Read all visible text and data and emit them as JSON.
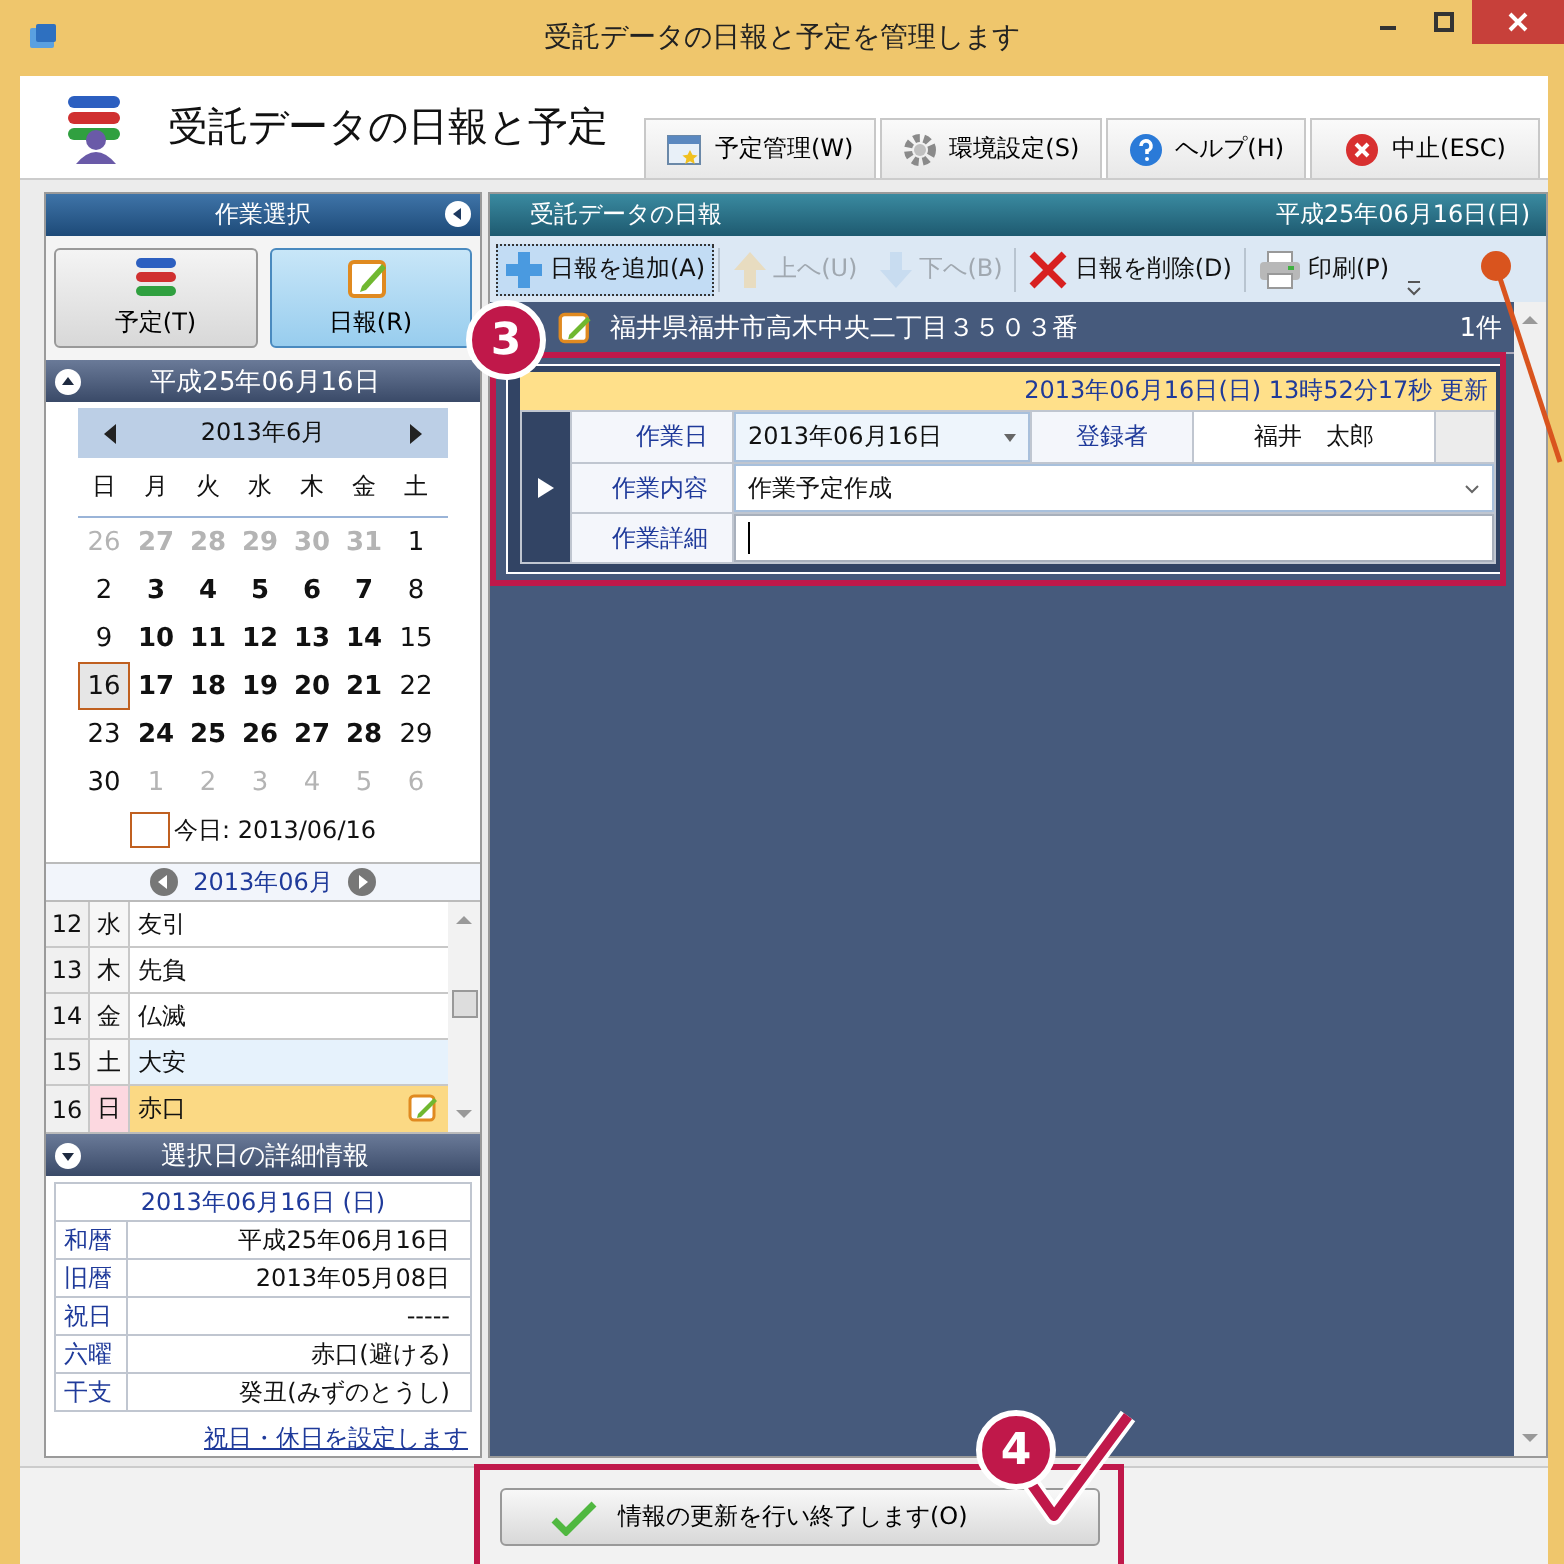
{
  "window": {
    "title": "受託データの日報と予定を管理します"
  },
  "header": {
    "title": "受託データの日報と予定",
    "buttons": [
      {
        "label": "予定管理(W)",
        "kind": "calendar"
      },
      {
        "label": "環境設定(S)",
        "kind": "gear"
      },
      {
        "label": "ヘルプ(H)",
        "kind": "help"
      },
      {
        "label": "中止(ESC)",
        "kind": "cancel"
      }
    ]
  },
  "left_panel": {
    "title": "作業選択",
    "modes": [
      {
        "label": "予定(T)",
        "kind": "schedule",
        "selected": false
      },
      {
        "label": "日報(R)",
        "kind": "report",
        "selected": true
      }
    ],
    "calendar": {
      "title": "平成25年06月16日",
      "month": "2013年6月",
      "weekdays": [
        "日",
        "月",
        "火",
        "水",
        "木",
        "金",
        "土"
      ],
      "weeks": [
        [
          {
            "day": "26",
            "outside": true,
            "bold": false,
            "selected": false
          },
          {
            "day": "27",
            "outside": true,
            "bold": true,
            "selected": false
          },
          {
            "day": "28",
            "outside": true,
            "bold": true,
            "selected": false
          },
          {
            "day": "29",
            "outside": true,
            "bold": true,
            "selected": false
          },
          {
            "day": "30",
            "outside": true,
            "bold": true,
            "selected": false
          },
          {
            "day": "31",
            "outside": true,
            "bold": true,
            "selected": false
          },
          {
            "day": "1",
            "outside": false,
            "bold": false,
            "selected": false
          }
        ],
        [
          {
            "day": "2",
            "outside": false,
            "bold": false,
            "selected": false
          },
          {
            "day": "3",
            "outside": false,
            "bold": true,
            "selected": false
          },
          {
            "day": "4",
            "outside": false,
            "bold": true,
            "selected": false
          },
          {
            "day": "5",
            "outside": false,
            "bold": true,
            "selected": false
          },
          {
            "day": "6",
            "outside": false,
            "bold": true,
            "selected": false
          },
          {
            "day": "7",
            "outside": false,
            "bold": true,
            "selected": false
          },
          {
            "day": "8",
            "outside": false,
            "bold": false,
            "selected": false
          }
        ],
        [
          {
            "day": "9",
            "outside": false,
            "bold": false,
            "selected": false
          },
          {
            "day": "10",
            "outside": false,
            "bold": true,
            "selected": false
          },
          {
            "day": "11",
            "outside": false,
            "bold": true,
            "selected": false
          },
          {
            "day": "12",
            "outside": false,
            "bold": true,
            "selected": false
          },
          {
            "day": "13",
            "outside": false,
            "bold": true,
            "selected": false
          },
          {
            "day": "14",
            "outside": false,
            "bold": true,
            "selected": false
          },
          {
            "day": "15",
            "outside": false,
            "bold": false,
            "selected": false
          }
        ],
        [
          {
            "day": "16",
            "outside": false,
            "bold": false,
            "selected": true
          },
          {
            "day": "17",
            "outside": false,
            "bold": true,
            "selected": false
          },
          {
            "day": "18",
            "outside": false,
            "bold": true,
            "selected": false
          },
          {
            "day": "19",
            "outside": false,
            "bold": true,
            "selected": false
          },
          {
            "day": "20",
            "outside": false,
            "bold": true,
            "selected": false
          },
          {
            "day": "21",
            "outside": false,
            "bold": true,
            "selected": false
          },
          {
            "day": "22",
            "outside": false,
            "bold": false,
            "selected": false
          }
        ],
        [
          {
            "day": "23",
            "outside": false,
            "bold": false,
            "selected": false
          },
          {
            "day": "24",
            "outside": false,
            "bold": true,
            "selected": false
          },
          {
            "day": "25",
            "outside": false,
            "bold": true,
            "selected": false
          },
          {
            "day": "26",
            "outside": false,
            "bold": true,
            "selected": false
          },
          {
            "day": "27",
            "outside": false,
            "bold": true,
            "selected": false
          },
          {
            "day": "28",
            "outside": false,
            "bold": true,
            "selected": false
          },
          {
            "day": "29",
            "outside": false,
            "bold": false,
            "selected": false
          }
        ],
        [
          {
            "day": "30",
            "outside": false,
            "bold": false,
            "selected": false
          },
          {
            "day": "1",
            "outside": true,
            "bold": false,
            "selected": false
          },
          {
            "day": "2",
            "outside": true,
            "bold": false,
            "selected": false
          },
          {
            "day": "3",
            "outside": true,
            "bold": false,
            "selected": false
          },
          {
            "day": "4",
            "outside": true,
            "bold": false,
            "selected": false
          },
          {
            "day": "5",
            "outside": true,
            "bold": false,
            "selected": false
          },
          {
            "day": "6",
            "outside": true,
            "bold": false,
            "selected": false
          }
        ]
      ],
      "today": "今日: 2013/06/16"
    },
    "day_list": {
      "month": "2013年06月",
      "rows": [
        {
          "day": "12",
          "weekday": "水",
          "rokuyo": "友引",
          "kind": "weekday",
          "selected": false,
          "has_report": false
        },
        {
          "day": "13",
          "weekday": "木",
          "rokuyo": "先負",
          "kind": "weekday",
          "selected": false,
          "has_report": false
        },
        {
          "day": "14",
          "weekday": "金",
          "rokuyo": "仏滅",
          "kind": "weekday",
          "selected": false,
          "has_report": false
        },
        {
          "day": "15",
          "weekday": "土",
          "rokuyo": "大安",
          "kind": "saturday",
          "selected": false,
          "has_report": false
        },
        {
          "day": "16",
          "weekday": "日",
          "rokuyo": "赤口",
          "kind": "sunday",
          "selected": true,
          "has_report": true
        }
      ]
    },
    "detail": {
      "title": "選択日の詳細情報",
      "date": "2013年06月16日 (日)",
      "rows": [
        {
          "label": "和暦",
          "value": "平成25年06月16日"
        },
        {
          "label": "旧暦",
          "value": "2013年05月08日"
        },
        {
          "label": "祝日",
          "value": "-----"
        },
        {
          "label": "六曜",
          "value": "赤口(避ける)"
        },
        {
          "label": "干支",
          "value": "癸丑(みずのとうし)"
        }
      ]
    },
    "link": "祝日・休日を設定します"
  },
  "report_panel": {
    "title": "受託データの日報",
    "date": "平成25年06月16日(日)",
    "toolbar": [
      {
        "label": "日報を追加(A)",
        "kind": "add",
        "disabled": false
      },
      {
        "label": "上へ(U)",
        "kind": "up",
        "disabled": true
      },
      {
        "label": "下へ(B)",
        "kind": "down",
        "disabled": true
      },
      {
        "label": "日報を削除(D)",
        "kind": "delete",
        "disabled": false
      },
      {
        "label": "印刷(P)",
        "kind": "print",
        "disabled": false
      }
    ],
    "group": {
      "title": "福井県福井市高木中央二丁目３５０３番",
      "count": "1件"
    },
    "record": {
      "updated": "2013年06月16日(日) 13時52分17秒  更新",
      "work_date": {
        "label": "作業日",
        "value": "2013年06月16日"
      },
      "registrant": {
        "label": "登録者",
        "value": "福井　太郎"
      },
      "content": {
        "label": "作業内容",
        "value": "作業予定作成"
      },
      "details": {
        "label": "作業詳細"
      }
    }
  },
  "footer": {
    "button": "情報の更新を行い終了します(O)"
  },
  "annotations": [
    {
      "number": "3"
    },
    {
      "number": "4"
    }
  ]
}
